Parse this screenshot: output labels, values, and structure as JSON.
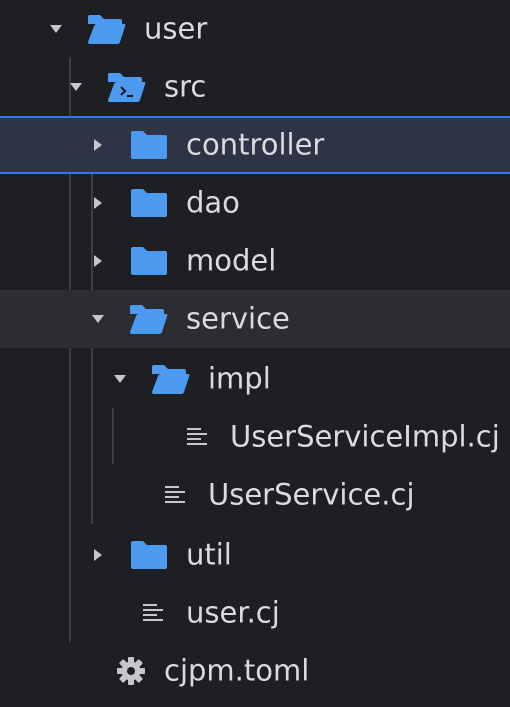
{
  "tree": {
    "nodes": [
      {
        "name": "user",
        "icon": "folder-open-icon"
      },
      {
        "name": "src",
        "icon": "source-folder-icon"
      },
      {
        "name": "controller",
        "icon": "folder-icon"
      },
      {
        "name": "dao",
        "icon": "folder-icon"
      },
      {
        "name": "model",
        "icon": "folder-icon"
      },
      {
        "name": "service",
        "icon": "folder-open-icon"
      },
      {
        "name": "impl",
        "icon": "folder-open-icon"
      },
      {
        "name": "UserServiceImpl.cj",
        "icon": "text-file-icon"
      },
      {
        "name": "UserService.cj",
        "icon": "text-file-icon"
      },
      {
        "name": "util",
        "icon": "folder-icon"
      },
      {
        "name": "user.cj",
        "icon": "text-file-icon"
      },
      {
        "name": "cjpm.toml",
        "icon": "gear-icon"
      }
    ]
  },
  "colors": {
    "background": "#1e1f22",
    "folder": "#4d9bf0",
    "selection_border": "#3574f0",
    "selection_fill": "#2e3445",
    "hover_fill": "#2b2d30",
    "text": "#d9dbdf"
  }
}
